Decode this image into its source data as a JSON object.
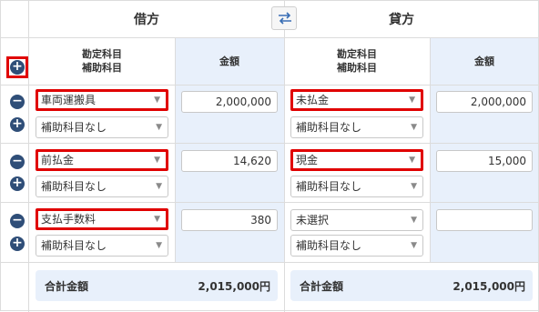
{
  "header": {
    "debit": "借方",
    "credit": "貸方"
  },
  "columns": {
    "account_line1": "勘定科目",
    "account_line2": "補助科目",
    "amount": "金額"
  },
  "rows": [
    {
      "debit_account": "車両運搬具",
      "debit_sub": "補助科目なし",
      "debit_amount": "2,000,000",
      "credit_account": "未払金",
      "credit_sub": "補助科目なし",
      "credit_amount": "2,000,000"
    },
    {
      "debit_account": "前払金",
      "debit_sub": "補助科目なし",
      "debit_amount": "14,620",
      "credit_account": "現金",
      "credit_sub": "補助科目なし",
      "credit_amount": "15,000"
    },
    {
      "debit_account": "支払手数料",
      "debit_sub": "補助科目なし",
      "debit_amount": "380",
      "credit_account": "未選択",
      "credit_sub": "補助科目なし",
      "credit_amount": ""
    }
  ],
  "totals": {
    "label": "合計金額",
    "debit": "2,015,000円",
    "credit": "2,015,000円"
  },
  "icons": {
    "swap": "swap-arrows-icon",
    "add": "plus-circle-icon",
    "remove": "minus-circle-icon",
    "dropdown": "dropdown-arrow-icon"
  },
  "colors": {
    "highlight": "#e00000",
    "amount_column_bg": "#e8f0fb",
    "button_circle": "#2f4e78"
  }
}
